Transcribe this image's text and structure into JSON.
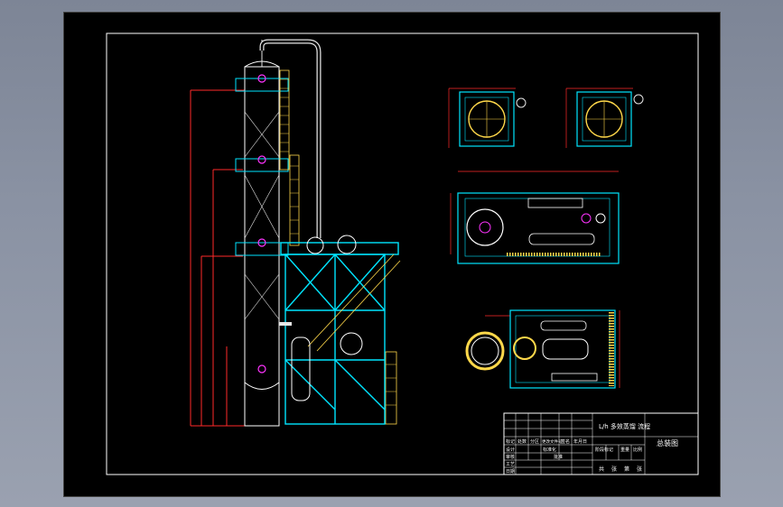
{
  "title_block": {
    "project_name": "L/h 多效蒸馏 流程",
    "drawing_name": "总装图",
    "row_labels": [
      "标记",
      "设计",
      "审核",
      "工艺",
      "日期"
    ],
    "header_cells": [
      "处数",
      "分区",
      "更改文件号",
      "签名",
      "年月日"
    ],
    "mid_cells": [
      "标准化",
      "批准"
    ],
    "stage_label": "阶段标记",
    "weight_label": "重量",
    "scale_label": "比例",
    "sheet_cells": [
      "共",
      "张",
      "第",
      "张"
    ]
  },
  "colors": {
    "background": "#000000",
    "border": "#ffffff",
    "structure": "#00e5ff",
    "dimension": "#ff2a2a",
    "platform": "#ffd84a",
    "nozzle": "#ff33ff",
    "pipe": "#e6e6e6"
  }
}
